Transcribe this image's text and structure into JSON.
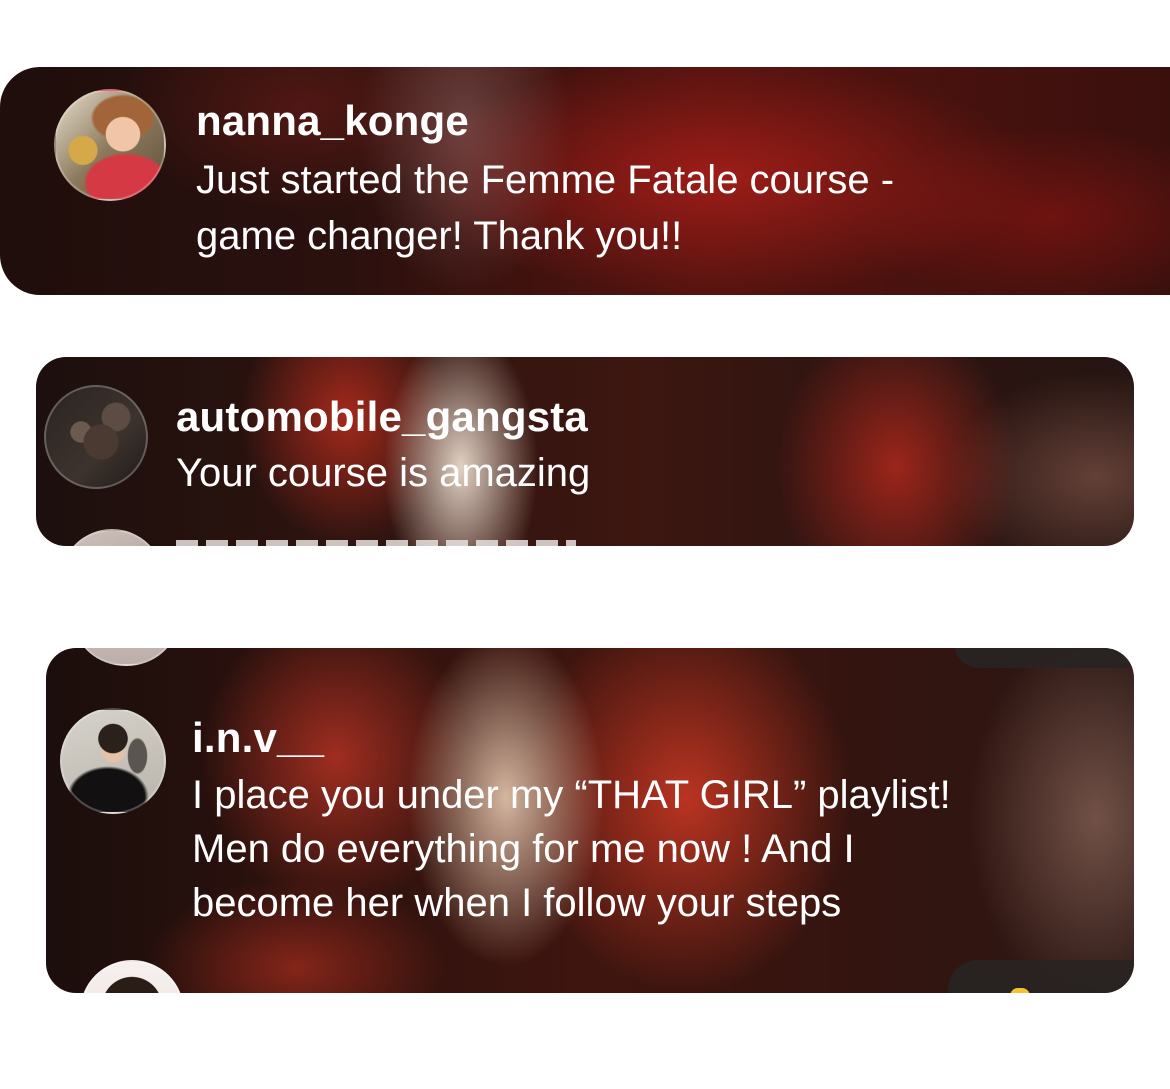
{
  "comments": [
    {
      "username": "nanna_konge",
      "message_lines": [
        "Just started the Femme Fatale course -",
        "game changer! Thank you!!"
      ],
      "avatar": "avatar-woman-red-top"
    },
    {
      "username": "automobile_gangsta",
      "message_lines": [
        "Your course is amazing"
      ],
      "avatar": "avatar-hands-rings"
    },
    {
      "username": "i.n.v__",
      "message_lines": [
        "I place you under my “THAT GIRL” playlist!",
        "Men do everything for me now ! And I",
        "become her when I follow your steps"
      ],
      "avatar": "avatar-woman-black-dress-selfie"
    }
  ]
}
